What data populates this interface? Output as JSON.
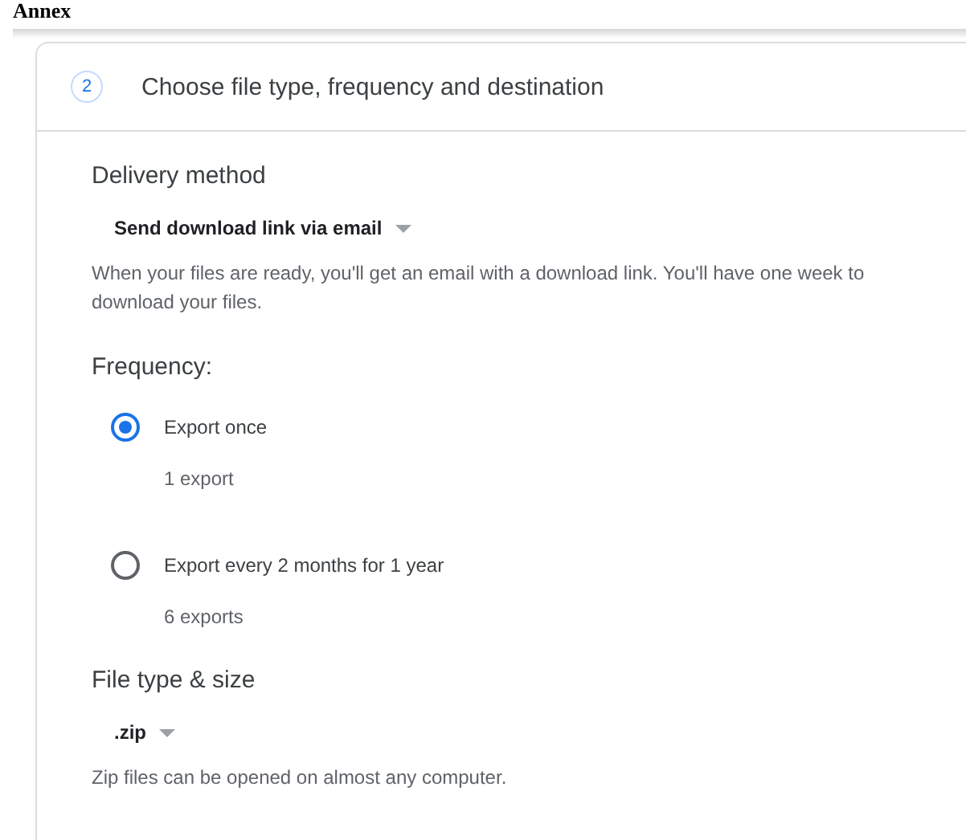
{
  "page_heading": "Annex",
  "step": {
    "number": "2",
    "title": "Choose file type, frequency and destination"
  },
  "delivery": {
    "label": "Delivery method",
    "value": "Send download link via email",
    "description": "When your files are ready, you'll get an email with a download link. You'll have one week to download your files."
  },
  "frequency": {
    "label": "Frequency:",
    "options": [
      {
        "label": "Export once",
        "detail": "1 export",
        "selected": true
      },
      {
        "label": "Export every 2 months for 1 year",
        "detail": "6 exports",
        "selected": false
      }
    ]
  },
  "file_type": {
    "label": "File type & size",
    "value": ".zip",
    "description": "Zip files can be opened on almost any computer."
  }
}
